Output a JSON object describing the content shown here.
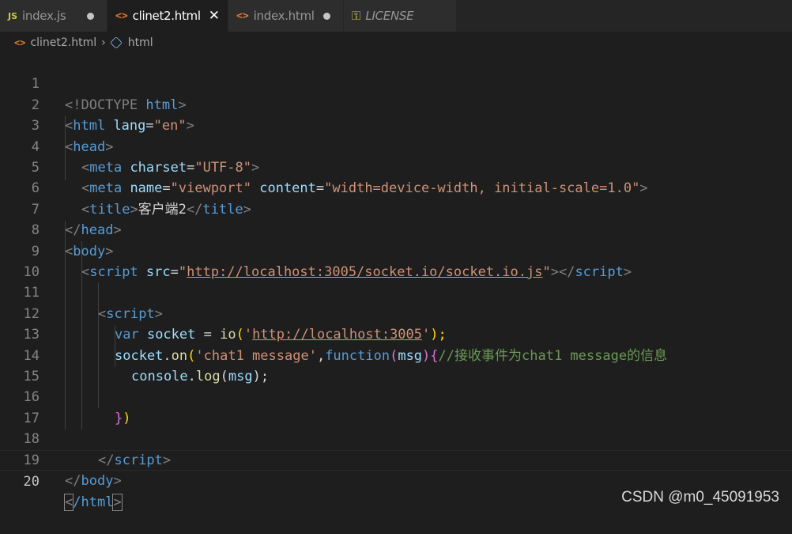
{
  "tabs": [
    {
      "badge": "JS",
      "label": "index.js",
      "state": "modified"
    },
    {
      "badge": "<>",
      "label": "clinet2.html",
      "state": "active"
    },
    {
      "badge": "<>",
      "label": "index.html",
      "state": "modified"
    },
    {
      "badge": "key-icon",
      "label": "LICENSE",
      "state": "normal"
    }
  ],
  "breadcrumb": {
    "file": "clinet2.html",
    "element": "html"
  },
  "line_numbers": [
    "1",
    "2",
    "3",
    "4",
    "5",
    "6",
    "7",
    "8",
    "9",
    "10",
    "11",
    "12",
    "13",
    "14",
    "15",
    "16",
    "17",
    "18",
    "19",
    "20"
  ],
  "code": {
    "l1": {
      "a": "<!DOCTYPE ",
      "b": "html",
      "c": ">"
    },
    "l2": {
      "a": "<",
      "b": "html",
      "c": " lang",
      "d": "=",
      "e": "\"en\"",
      "f": ">"
    },
    "l3": {
      "a": "<",
      "b": "head",
      "c": ">"
    },
    "l4": {
      "a": "<",
      "b": "meta",
      "c": " charset",
      "d": "=",
      "e": "\"UTF-8\"",
      "f": ">"
    },
    "l5": {
      "a": "<",
      "b": "meta",
      "c": " name",
      "d": "=",
      "e": "\"viewport\"",
      "f": " content",
      "g": "=",
      "h": "\"width=device-width, initial-scale=1.0\"",
      "i": ">"
    },
    "l6": {
      "a": "<",
      "b": "title",
      "c": ">",
      "d": "客户端2",
      "e": "</",
      "f": "title",
      "g": ">"
    },
    "l7": {
      "a": "</",
      "b": "head",
      "c": ">"
    },
    "l8": {
      "a": "<",
      "b": "body",
      "c": ">"
    },
    "l9": {
      "a": "<",
      "b": "script",
      "c": " src",
      "d": "=",
      "e": "\"",
      "f": "http://localhost:3005/socket.io/socket.io.js",
      "g": "\"",
      "h": "></",
      "i": "script",
      "j": ">"
    },
    "l11": {
      "a": "<",
      "b": "script",
      "c": ">"
    },
    "l12": {
      "a": "var ",
      "b": "socket",
      "c": " = ",
      "d": "io",
      "e": "(",
      "f": "'",
      "g": "http://localhost:3005",
      "h": "'",
      "i": ");"
    },
    "l13": {
      "a": "socket",
      "b": ".",
      "c": "on",
      "d": "(",
      "e": "'chat1 message'",
      "f": ",",
      "g": "function",
      "h": "(",
      "i": "msg",
      "j": ")",
      "k": "{",
      "l": "//接收事件为chat1 message的信息"
    },
    "l14": {
      "a": "console",
      "b": ".",
      "c": "log",
      "d": "(",
      "e": "msg",
      "f": ");"
    },
    "l16": {
      "a": "}",
      "b": ")"
    },
    "l18": {
      "a": "</",
      "b": "script",
      "c": ">"
    },
    "l19": {
      "a": "</",
      "b": "body",
      "c": ">"
    },
    "l20": {
      "a": "<",
      "b": "/html",
      "c": ">"
    }
  },
  "watermark": "CSDN @m0_45091953"
}
